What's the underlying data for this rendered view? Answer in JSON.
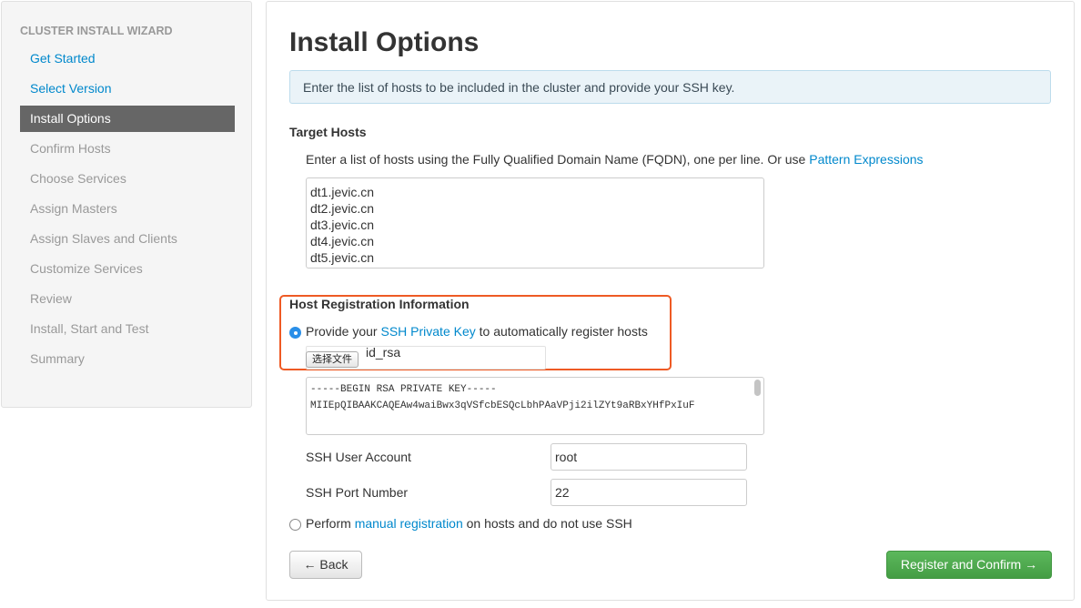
{
  "sidebar": {
    "header": "CLUSTER INSTALL WIZARD",
    "items": [
      {
        "label": "Get Started"
      },
      {
        "label": "Select Version"
      },
      {
        "label": "Install Options"
      },
      {
        "label": "Confirm Hosts"
      },
      {
        "label": "Choose Services"
      },
      {
        "label": "Assign Masters"
      },
      {
        "label": "Assign Slaves and Clients"
      },
      {
        "label": "Customize Services"
      },
      {
        "label": "Review"
      },
      {
        "label": "Install, Start and Test"
      },
      {
        "label": "Summary"
      }
    ]
  },
  "main": {
    "title": "Install Options",
    "alert": "Enter the list of hosts to be included in the cluster and provide your SSH key.",
    "target_hosts": {
      "heading": "Target Hosts",
      "desc_prefix": "Enter a list of hosts using the Fully Qualified Domain Name (FQDN), one per line. Or use ",
      "desc_link": "Pattern Expressions",
      "hosts_value": "dt1.jevic.cn\ndt2.jevic.cn\ndt3.jevic.cn\ndt4.jevic.cn\ndt5.jevic.cn"
    },
    "registration": {
      "heading": "Host Registration Information",
      "option1_prefix": "Provide your ",
      "option1_link": "SSH Private Key",
      "option1_suffix": " to automatically register hosts",
      "file_button": "选择文件",
      "file_name": "id_rsa",
      "key_text": "-----BEGIN RSA PRIVATE KEY-----\nMIIEpQIBAAKCAQEAw4waiBwx3qVSfcbESQcLbhPAaVPji2ilZYt9aRBxYHfPxIuF",
      "ssh_user_label": "SSH User Account",
      "ssh_user_value": "root",
      "ssh_port_label": "SSH Port Number",
      "ssh_port_value": "22",
      "option2_prefix": "Perform ",
      "option2_link": "manual registration",
      "option2_suffix": " on hosts and do not use SSH"
    },
    "buttons": {
      "back": "← Back",
      "next": "Register and Confirm →"
    }
  },
  "colors": {
    "link": "#0088cc",
    "active_nav": "#666666",
    "highlight_border": "#ee5a24",
    "primary_button": "#5cb85c",
    "radio_selected": "#2a8fe8"
  }
}
